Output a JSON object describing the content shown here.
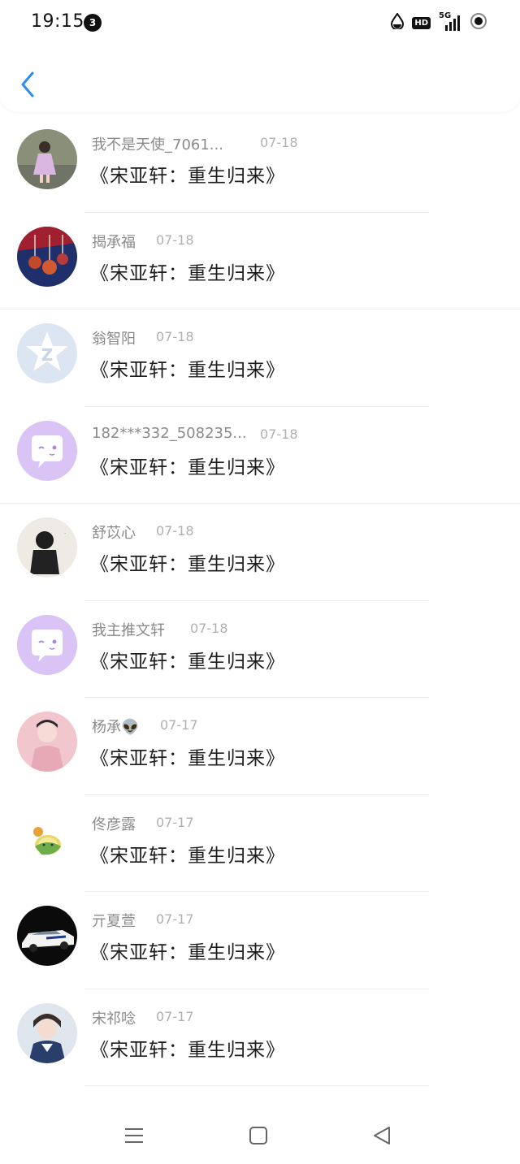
{
  "status_bar": {
    "time": "19:15",
    "notification_count": "3",
    "hd_label": "HD",
    "network_label": "5G"
  },
  "header": {
    "back_icon": "chevron-left-icon"
  },
  "items": [
    {
      "name": "我不是天使_7061...",
      "date": "07-18",
      "message": "《宋亚轩：重生归来》"
    },
    {
      "name": "揭承福",
      "date": "07-18",
      "message": "《宋亚轩：重生归来》"
    },
    {
      "name": "翁智阳",
      "date": "07-18",
      "message": "《宋亚轩：重生归来》"
    },
    {
      "name": "182***332_508235...",
      "date": "07-18",
      "message": "《宋亚轩：重生归来》"
    },
    {
      "name": "舒苡心",
      "date": "07-18",
      "message": "《宋亚轩：重生归来》"
    },
    {
      "name": "我主推文轩",
      "date": "07-18",
      "message": "《宋亚轩：重生归来》"
    },
    {
      "name": "杨承👽",
      "date": "07-17",
      "message": "《宋亚轩：重生归来》"
    },
    {
      "name": "佟彦露",
      "date": "07-17",
      "message": "《宋亚轩：重生归来》"
    },
    {
      "name": "亓夏萱",
      "date": "07-17",
      "message": "《宋亚轩：重生归来》"
    },
    {
      "name": "宋祁唸",
      "date": "07-17",
      "message": "《宋亚轩：重生归来》"
    }
  ],
  "colors": {
    "accent": "#2d8cf0",
    "name_text": "#8a8a8a",
    "date_text": "#b0b0b0"
  }
}
